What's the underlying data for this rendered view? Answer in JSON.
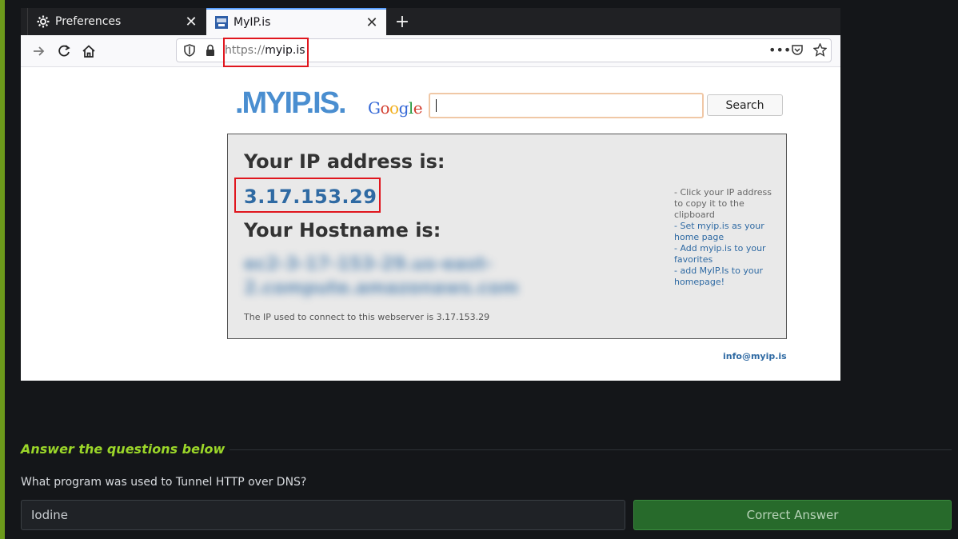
{
  "browser": {
    "tabs": [
      {
        "label": "Preferences",
        "icon": "gear-icon"
      },
      {
        "label": "MyIP.is",
        "icon": "myip-favicon"
      }
    ],
    "url_scheme": "https://",
    "url_host": "myip.is"
  },
  "page": {
    "logo_text": ".MYIP.IS.",
    "google_text": "Google",
    "search_button": "Search",
    "ip_title": "Your IP address is:",
    "ip_value": "3.17.153.29",
    "hostname_title": "Your Hostname is:",
    "hostname_value": "ec2-3-17-153-29.us-east-2.compute.amazonaws.com",
    "connect_note": "The IP used to connect to this webserver is 3.17.153.29",
    "tips": [
      "- Click your IP address to copy it to the clipboard",
      "- Set myip.is as your home page",
      "- Add myip.is to your favorites",
      "- add MyIP.Is to your homepage!"
    ],
    "info_email": "info@myip.is"
  },
  "task": {
    "heading": "Answer the questions below",
    "question": "What program was used to Tunnel HTTP over DNS?",
    "answer_value": "Iodine",
    "correct_label": "Correct Answer"
  },
  "colors": {
    "accent_green": "#9bd629",
    "link_blue": "#2f6aa3",
    "highlight_red": "#e0161e",
    "correct_green": "#276a2b"
  }
}
